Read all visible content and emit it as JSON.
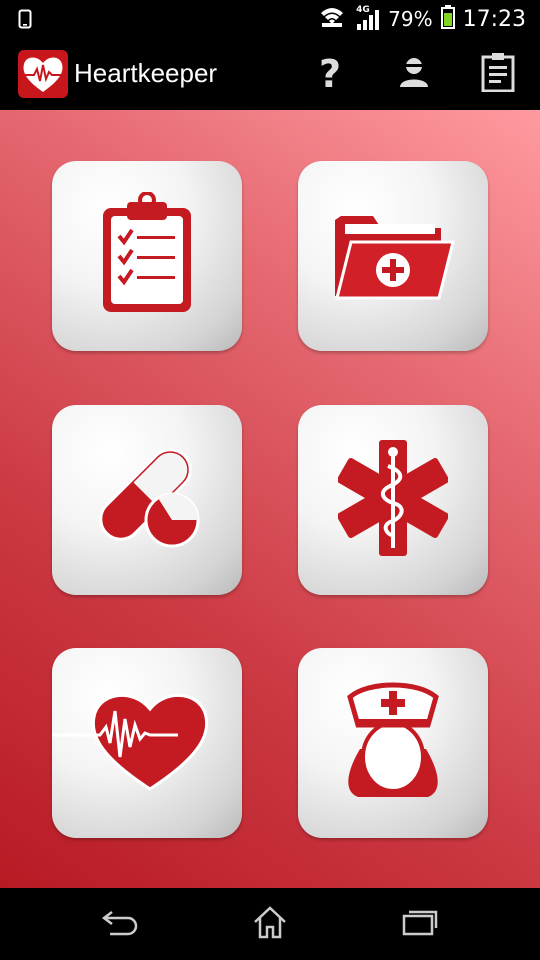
{
  "status_bar": {
    "network": "4G",
    "battery_percent": "79%",
    "time": "17:23"
  },
  "action_bar": {
    "title": "Heartkeeper",
    "help_label": "?"
  },
  "colors": {
    "accent": "#c8161d",
    "tile_face": "#f0f0f0",
    "background_top": "#ff9aa0",
    "background_bottom": "#b81a24"
  },
  "tiles": [
    {
      "icon": "clipboard-checklist-icon"
    },
    {
      "icon": "medical-folder-icon"
    },
    {
      "icon": "pills-icon"
    },
    {
      "icon": "star-of-life-icon"
    },
    {
      "icon": "heartbeat-icon"
    },
    {
      "icon": "nurse-icon"
    }
  ]
}
